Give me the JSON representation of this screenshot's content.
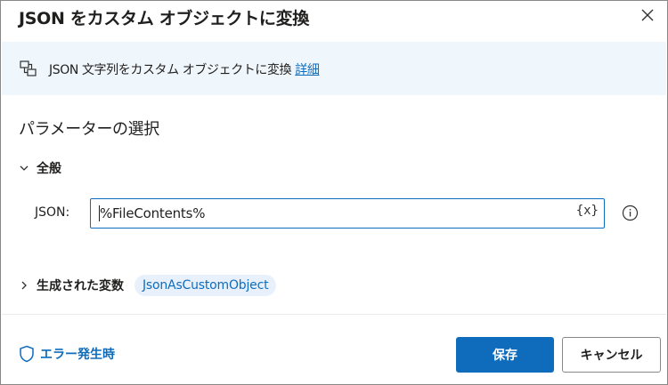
{
  "dialog": {
    "title": "JSON をカスタム オブジェクトに変換"
  },
  "banner": {
    "description": "JSON 文字列をカスタム オブジェクトに変換",
    "link_label": "詳細"
  },
  "parameters": {
    "section_title": "パラメーターの選択",
    "group_label": "全般",
    "json_label": "JSON:",
    "json_value": "%FileContents%",
    "variable_button": "{x}"
  },
  "variables": {
    "header_label": "生成された変数",
    "chip_label": "JsonAsCustomObject"
  },
  "footer": {
    "error_label": "エラー発生時",
    "save_label": "保存",
    "cancel_label": "キャンセル"
  },
  "colors": {
    "accent": "#0f6cbd",
    "banner_bg": "#eff6fc",
    "chip_bg": "#e8f1fb"
  },
  "icons": {
    "close": "close-icon",
    "banner": "action-icon",
    "chevron_expanded": "chevron-down-icon",
    "chevron_collapsed": "chevron-right-icon",
    "info": "info-icon",
    "shield": "shield-icon"
  }
}
